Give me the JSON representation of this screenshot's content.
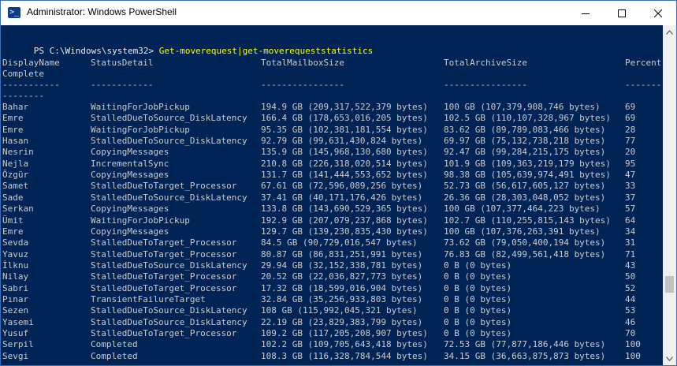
{
  "window": {
    "title": "Administrator: Windows PowerShell"
  },
  "console": {
    "prompt": "PS C:\\Windows\\system32> ",
    "command": "Get-moverequest|get-moverequeststatistics",
    "headers": {
      "name": "DisplayName",
      "status": "StatusDetail",
      "size": "TotalMailboxSize",
      "archive": "TotalArchiveSize",
      "percent": "Percent",
      "percent_wrap": "Complete"
    },
    "separators": {
      "name": "-----------",
      "status": "------------",
      "size": "----------------",
      "archive": "----------------",
      "percent": "-------",
      "percent_wrap": "--------"
    },
    "rows": [
      {
        "name": "Bahar",
        "status": "WaitingForJobPickup",
        "size": "194.9 GB (209,317,522,379 bytes)",
        "archive": "100 GB (107,379,908,746 bytes)",
        "percent": "69"
      },
      {
        "name": "Emre",
        "status": "StalledDueToSource_DiskLatency",
        "size": "166.4 GB (178,653,016,205 bytes)",
        "archive": "102.5 GB (110,107,328,967 bytes)",
        "percent": "69"
      },
      {
        "name": "Emre",
        "status": "WaitingForJobPickup",
        "size": "95.35 GB (102,381,181,554 bytes)",
        "archive": "83.62 GB (89,789,083,466 bytes)",
        "percent": "28"
      },
      {
        "name": "Hasan",
        "status": "StalledDueToSource_DiskLatency",
        "size": "92.79 GB (99,631,430,824 bytes)",
        "archive": "69.97 GB (75,132,738,218 bytes)",
        "percent": "77"
      },
      {
        "name": "Nesrin",
        "status": "CopyingMessages",
        "size": "135.9 GB (145,968,130,680 bytes)",
        "archive": "92.47 GB (99,284,215,175 bytes)",
        "percent": "20"
      },
      {
        "name": "Nejla",
        "status": "IncrementalSync",
        "size": "210.8 GB (226,318,020,514 bytes)",
        "archive": "101.9 GB (109,363,219,179 bytes)",
        "percent": "95"
      },
      {
        "name": "Özgür",
        "status": "CopyingMessages",
        "size": "131.7 GB (141,444,553,652 bytes)",
        "archive": "98.38 GB (105,639,974,491 bytes)",
        "percent": "47"
      },
      {
        "name": "Samet",
        "status": "StalledDueToTarget_Processor",
        "size": "67.61 GB (72,596,089,256 bytes)",
        "archive": "52.73 GB (56,617,605,127 bytes)",
        "percent": "33"
      },
      {
        "name": "Sade",
        "status": "StalledDueToSource_DiskLatency",
        "size": "37.41 GB (40,171,176,426 bytes)",
        "archive": "26.36 GB (28,303,048,052 bytes)",
        "percent": "37"
      },
      {
        "name": "Serkan",
        "status": "CopyingMessages",
        "size": "133.8 GB (143,690,529,365 bytes)",
        "archive": "100 GB (107,377,464,223 bytes)",
        "percent": "57"
      },
      {
        "name": "Ümit",
        "status": "WaitingForJobPickup",
        "size": "192.9 GB (207,079,237,868 bytes)",
        "archive": "102.7 GB (110,255,815,143 bytes)",
        "percent": "64"
      },
      {
        "name": "Emre",
        "status": "CopyingMessages",
        "size": "129.7 GB (139,230,835,430 bytes)",
        "archive": "100 GB (107,376,263,391 bytes)",
        "percent": "34"
      },
      {
        "name": "Sevda",
        "status": "StalledDueToTarget_Processor",
        "size": "84.5 GB (90,729,016,547 bytes)",
        "archive": "73.62 GB (79,050,400,194 bytes)",
        "percent": "31"
      },
      {
        "name": "Yavuz",
        "status": "StalledDueToTarget_Processor",
        "size": "80.87 GB (86,831,251,991 bytes)",
        "archive": "76.83 GB (82,499,561,418 bytes)",
        "percent": "71"
      },
      {
        "name": "İlknu",
        "status": "StalledDueToSource_DiskLatency",
        "size": "29.94 GB (32,152,338,781 bytes)",
        "archive": "0 B (0 bytes)",
        "percent": "43"
      },
      {
        "name": "Nilay",
        "status": "StalledDueToTarget_Processor",
        "size": "20.52 GB (22,036,827,773 bytes)",
        "archive": "0 B (0 bytes)",
        "percent": "50"
      },
      {
        "name": "Sabri",
        "status": "StalledDueToTarget_Processor",
        "size": "17.32 GB (18,599,016,904 bytes)",
        "archive": "0 B (0 bytes)",
        "percent": "52"
      },
      {
        "name": "Pınar",
        "status": "TransientFailureTarget",
        "size": "32.84 GB (35,256,933,803 bytes)",
        "archive": "0 B (0 bytes)",
        "percent": "44"
      },
      {
        "name": "Sezen",
        "status": "StalledDueToSource_DiskLatency",
        "size": "108 GB (115,992,045,321 bytes)",
        "archive": "0 B (0 bytes)",
        "percent": "53"
      },
      {
        "name": "Yasemi",
        "status": "StalledDueToSource_DiskLatency",
        "size": "22.19 GB (23,829,383,799 bytes)",
        "archive": "0 B (0 bytes)",
        "percent": "46"
      },
      {
        "name": "Yusuf",
        "status": "StalledDueToTarget_Processor",
        "size": "109.2 GB (117,205,208,907 bytes)",
        "archive": "0 B (0 bytes)",
        "percent": "70"
      },
      {
        "name": "Serpil",
        "status": "Completed",
        "size": "102.2 GB (109,705,643,418 bytes)",
        "archive": "72.53 GB (77,877,186,446 bytes)",
        "percent": "100"
      },
      {
        "name": "Sevgi",
        "status": "Completed",
        "size": "108.3 GB (116,328,784,544 bytes)",
        "archive": "34.15 GB (36,663,875,873 bytes)",
        "percent": "100"
      }
    ]
  },
  "icons": {
    "app": "powershell-icon",
    "minimize": "minimize-icon",
    "maximize": "maximize-icon",
    "close": "close-icon",
    "scroll_up": "chevron-up-icon",
    "scroll_down": "chevron-down-icon"
  },
  "colors": {
    "console_bg": "#012456",
    "text": "#cccccc",
    "command": "#ffff00"
  }
}
